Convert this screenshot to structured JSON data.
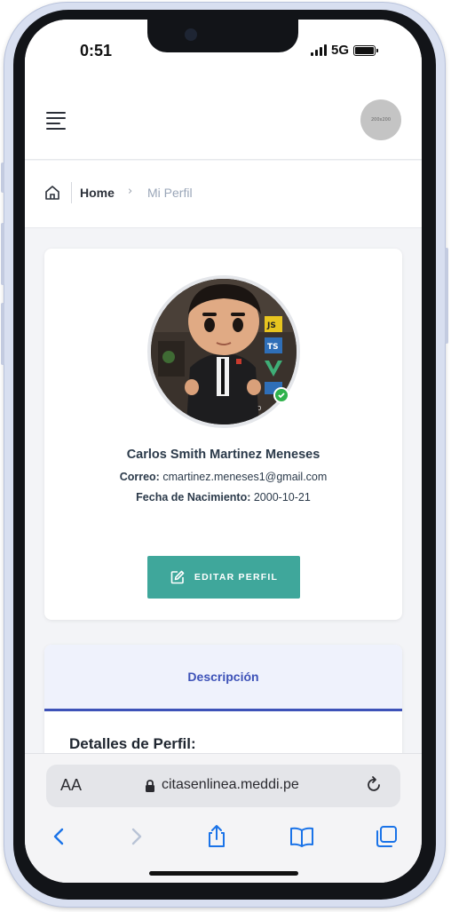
{
  "status_bar": {
    "time": "0:51",
    "network": "5G"
  },
  "header": {
    "avatar_placeholder": "200x200"
  },
  "breadcrumb": {
    "home": "Home",
    "separator": "›",
    "current": "Mi Perfil"
  },
  "profile": {
    "name": "Carlos Smith Martinez Meneses",
    "email_label": "Correo:",
    "email": "cmartinez.meneses1@gmail.com",
    "birth_label": "Fecha de Nacimiento:",
    "birth_date": "2000-10-21",
    "edit_button": "EDITAR PERFIL",
    "photo_badges": [
      "JS",
      "TS"
    ],
    "photo_caption": "FRO"
  },
  "tabs": {
    "description": "Descripción"
  },
  "details": {
    "heading": "Detalles de Perfil:"
  },
  "browser": {
    "text_size_label": "AA",
    "url": "citasenlinea.meddi.pe"
  },
  "colors": {
    "accent": "#3fa79b",
    "tab_active": "#3d52b8",
    "tab_bg": "#eff2fc",
    "ios_blue": "#1a73e8"
  }
}
